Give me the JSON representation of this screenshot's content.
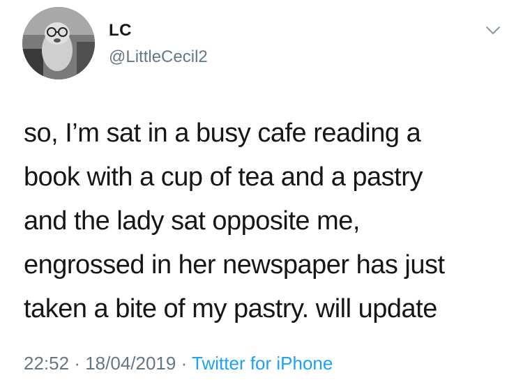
{
  "author": {
    "name": "LC",
    "handle": "@LittleCecil2"
  },
  "tweet": {
    "lines": [
      "so, I’m sat in a busy cafe reading a",
      "book with a cup of tea and a pastry",
      "and the lady sat opposite me,",
      "engrossed in her newspaper has just",
      "taken a bite of my pastry. will update"
    ],
    "time": "22:52",
    "separator": "·",
    "date": "18/04/2019",
    "source": "Twitter for iPhone"
  },
  "icons": {
    "menu": "chevron-down-icon",
    "avatar": "avatar"
  },
  "colors": {
    "text": "#14171a",
    "secondary": "#657786",
    "link": "#1da1f2"
  }
}
